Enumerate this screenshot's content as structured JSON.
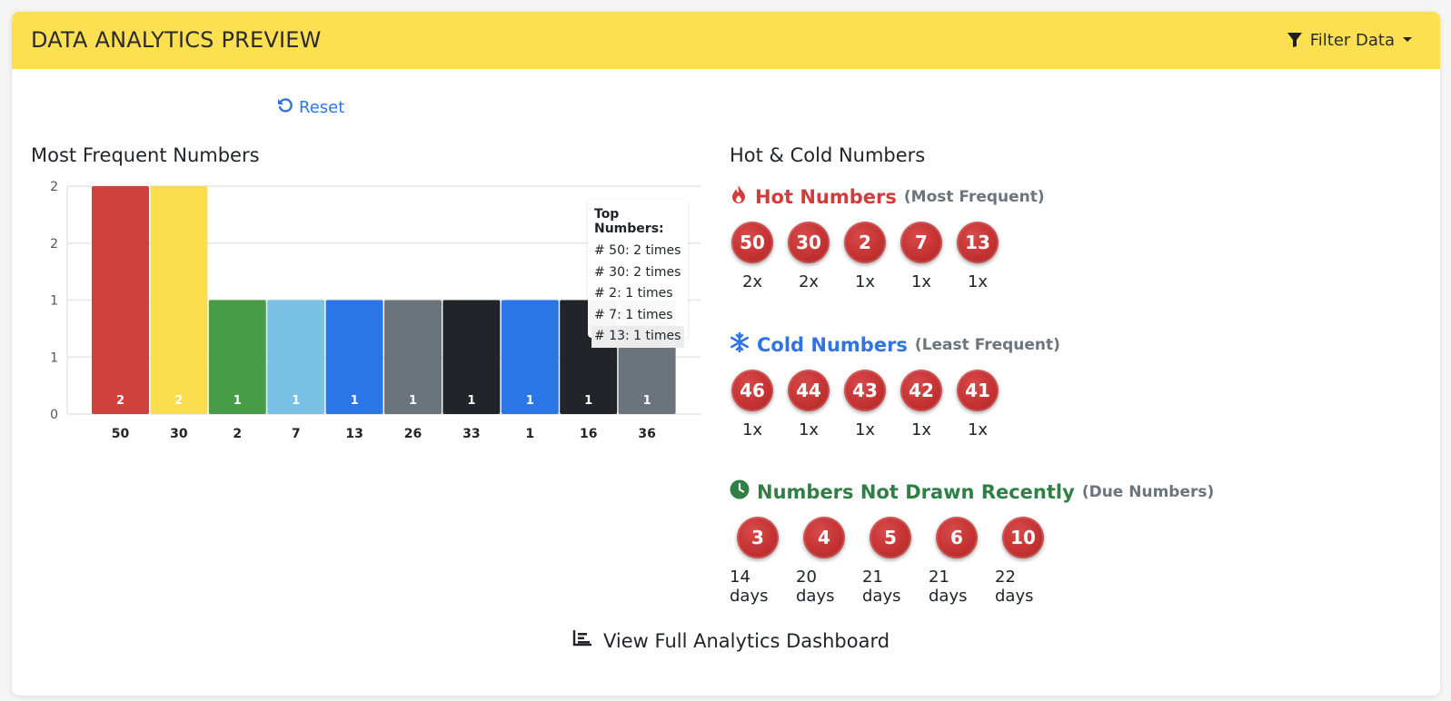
{
  "header": {
    "title": "DATA ANALYTICS PREVIEW",
    "filter_label": "Filter Data",
    "bg_color": "#fce052"
  },
  "reset_label": "Reset",
  "frequent": {
    "title": "Most Frequent Numbers"
  },
  "chart_data": {
    "type": "bar",
    "categories": [
      "50",
      "30",
      "2",
      "7",
      "13",
      "26",
      "33",
      "1",
      "16",
      "36"
    ],
    "values": [
      2,
      2,
      1,
      1,
      1,
      1,
      1,
      1,
      1,
      1
    ],
    "colors": [
      "#d0413e",
      "#fbde4f",
      "#469c47",
      "#79c2e6",
      "#2a76e8",
      "#6b747d",
      "#212529",
      "#2a76e8",
      "#212529",
      "#6b747d"
    ],
    "y_tick_labels": [
      "0",
      "1",
      "1",
      "2",
      "2"
    ],
    "ylim": [
      0,
      2
    ],
    "grid": true,
    "tooltip": {
      "title": "Top Numbers:",
      "rows": [
        "# 50: 2 times",
        "# 30: 2 times",
        "# 2: 1 times",
        "# 7: 1 times",
        "# 13: 1 times"
      ]
    }
  },
  "hotcold": {
    "title": "Hot & Cold Numbers",
    "hot": {
      "label": "Hot Numbers",
      "sub": "(Most Frequent)",
      "icon": "fire-icon",
      "balls": [
        {
          "num": "50",
          "caption": "2x"
        },
        {
          "num": "30",
          "caption": "2x"
        },
        {
          "num": "2",
          "caption": "1x"
        },
        {
          "num": "7",
          "caption": "1x"
        },
        {
          "num": "13",
          "caption": "1x"
        }
      ]
    },
    "cold": {
      "label": "Cold Numbers",
      "sub": "(Least Frequent)",
      "icon": "snowflake-icon",
      "balls": [
        {
          "num": "46",
          "caption": "1x"
        },
        {
          "num": "44",
          "caption": "1x"
        },
        {
          "num": "43",
          "caption": "1x"
        },
        {
          "num": "42",
          "caption": "1x"
        },
        {
          "num": "41",
          "caption": "1x"
        }
      ]
    },
    "due": {
      "label": "Numbers Not Drawn Recently",
      "sub": "(Due Numbers)",
      "icon": "clock-icon",
      "balls": [
        {
          "num": "3",
          "caption": "14 days"
        },
        {
          "num": "4",
          "caption": "20 days"
        },
        {
          "num": "5",
          "caption": "21 days"
        },
        {
          "num": "6",
          "caption": "21 days"
        },
        {
          "num": "10",
          "caption": "22 days"
        }
      ]
    }
  },
  "footer": {
    "link_label": "View Full Analytics Dashboard"
  }
}
